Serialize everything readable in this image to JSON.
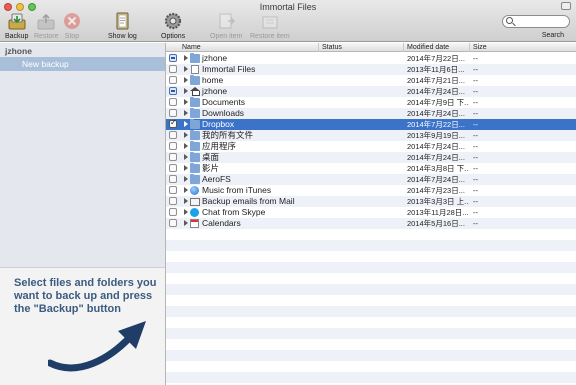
{
  "window": {
    "title": "Immortal Files"
  },
  "toolbar": {
    "backup": "Backup",
    "restore": "Restore",
    "stop": "Stop",
    "show_log": "Show log",
    "options": "Options",
    "open_item": "Open item",
    "restore_item": "Restore item",
    "search_label": "Search",
    "search_placeholder": ""
  },
  "sidebar": {
    "user": "jzhone",
    "backup_item": "New backup",
    "hint": "Select files and folders you want to back up and press the \"Backup\" button"
  },
  "table": {
    "columns": [
      "Name",
      "Status",
      "Modified date",
      "Size"
    ],
    "rows": [
      {
        "name": "jzhone",
        "status": "",
        "date": "2014年7月22日...",
        "size": "--",
        "check": "partial",
        "icon": "folder-icon",
        "selected": false
      },
      {
        "name": "Immortal Files",
        "status": "",
        "date": "2013年11月6日...",
        "size": "--",
        "check": "none",
        "icon": "document-icon",
        "selected": false
      },
      {
        "name": "home",
        "status": "",
        "date": "2014年7月21日...",
        "size": "--",
        "check": "none",
        "icon": "folder-icon",
        "selected": false
      },
      {
        "name": "jzhone",
        "status": "",
        "date": "2014年7月24日...",
        "size": "--",
        "check": "partial",
        "icon": "home-icon",
        "selected": false
      },
      {
        "name": "Documents",
        "status": "",
        "date": "2014年7月9日 下...",
        "size": "--",
        "check": "none",
        "icon": "folder-icon",
        "selected": false
      },
      {
        "name": "Downloads",
        "status": "",
        "date": "2014年7月24日...",
        "size": "--",
        "check": "none",
        "icon": "folder-icon",
        "selected": false
      },
      {
        "name": "Dropbox",
        "status": "",
        "date": "2014年7月22日...",
        "size": "--",
        "check": "checked",
        "icon": "folder-icon",
        "selected": true
      },
      {
        "name": "我的所有文件",
        "status": "",
        "date": "2013年9月19日...",
        "size": "--",
        "check": "none",
        "icon": "folder-icon",
        "selected": false
      },
      {
        "name": "应用程序",
        "status": "",
        "date": "2014年7月24日...",
        "size": "--",
        "check": "none",
        "icon": "folder-icon",
        "selected": false
      },
      {
        "name": "桌面",
        "status": "",
        "date": "2014年7月24日...",
        "size": "--",
        "check": "none",
        "icon": "folder-icon",
        "selected": false
      },
      {
        "name": "影片",
        "status": "",
        "date": "2014年3月8日 下...",
        "size": "--",
        "check": "none",
        "icon": "folder-icon",
        "selected": false
      },
      {
        "name": "AeroFS",
        "status": "",
        "date": "2014年7月24日...",
        "size": "--",
        "check": "none",
        "icon": "folder-icon",
        "selected": false
      },
      {
        "name": "Music from iTunes",
        "status": "",
        "date": "2014年7月23日...",
        "size": "--",
        "check": "none",
        "icon": "globe-icon",
        "selected": false
      },
      {
        "name": "Backup emails from Mail",
        "status": "",
        "date": "2013年3月3日 上...",
        "size": "--",
        "check": "none",
        "icon": "mail-icon",
        "selected": false
      },
      {
        "name": "Chat from Skype",
        "status": "",
        "date": "2013年11月28日...",
        "size": "--",
        "check": "none",
        "icon": "skype-icon",
        "selected": false
      },
      {
        "name": "Calendars",
        "status": "",
        "date": "2014年5月16日...",
        "size": "--",
        "check": "none",
        "icon": "calendar-icon",
        "selected": false
      }
    ]
  },
  "colors": {
    "selection": "#3b73c8",
    "sidebar_selection": "#a9bfd9",
    "hint_text": "#3b5b80"
  }
}
